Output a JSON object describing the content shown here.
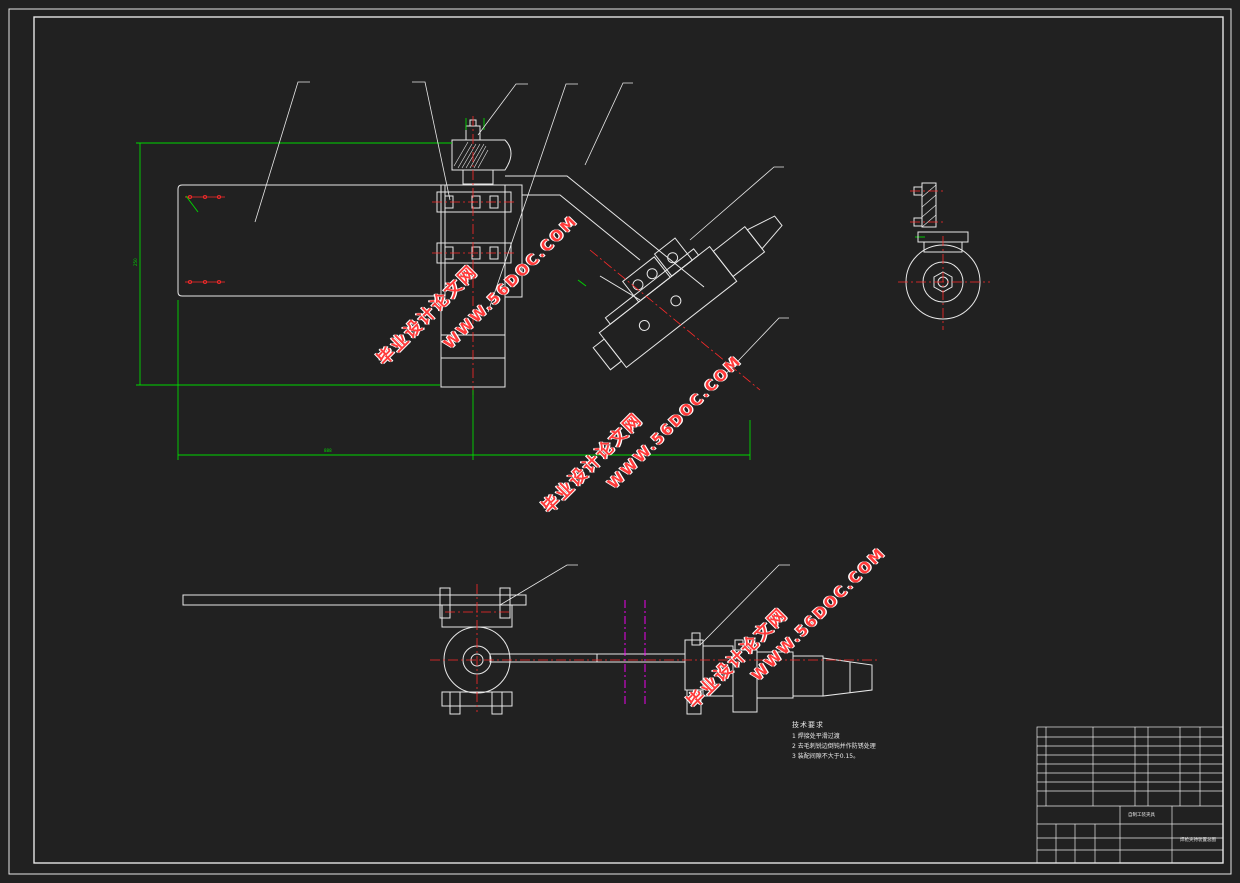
{
  "notes": {
    "heading": "技术要求",
    "items": [
      "1 焊接处平滑过渡",
      "2 去毛刺锐边倒钝并作防锈处理",
      "3 装配间隙不大于0.15。"
    ]
  },
  "watermarks": [
    {
      "line1": "毕业设计论文网",
      "line2": "WWW.56DOC.COM"
    },
    {
      "line1": "毕业设计论文网",
      "line2": "WWW.56DOC.COM"
    },
    {
      "line1": "毕业设计论文网",
      "line2": "WWW.56DOC.COM"
    }
  ],
  "dimensions": {
    "horizontal": "888",
    "vertical": "250"
  },
  "title_block": {
    "design_title": "自制工装夹具",
    "drawing_name": "焊枪夹持装置总图"
  },
  "colors": {
    "background": "#212121",
    "line": "#ffffff",
    "dimension": "#00d800",
    "centerline": "#ff2a2a",
    "phantom": "#ff00ff"
  }
}
